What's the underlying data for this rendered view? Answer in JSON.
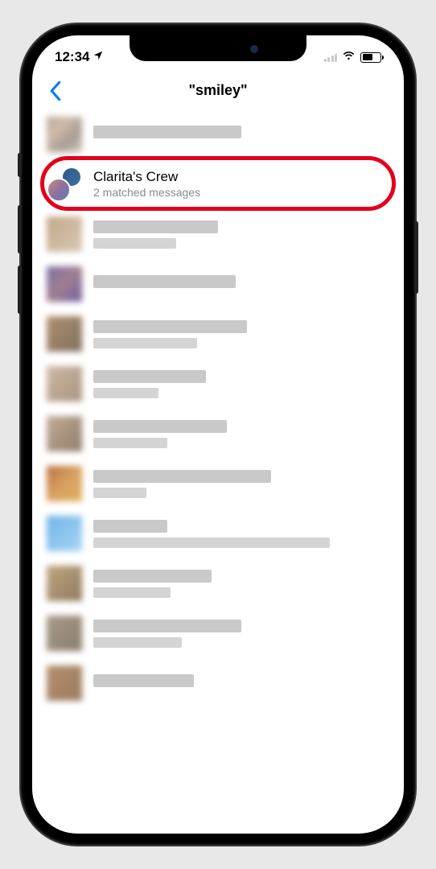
{
  "status": {
    "time": "12:34"
  },
  "nav": {
    "title": "\"smiley\""
  },
  "highlighted": {
    "name": "Clarita's Crew",
    "subtitle": "2 matched messages"
  }
}
